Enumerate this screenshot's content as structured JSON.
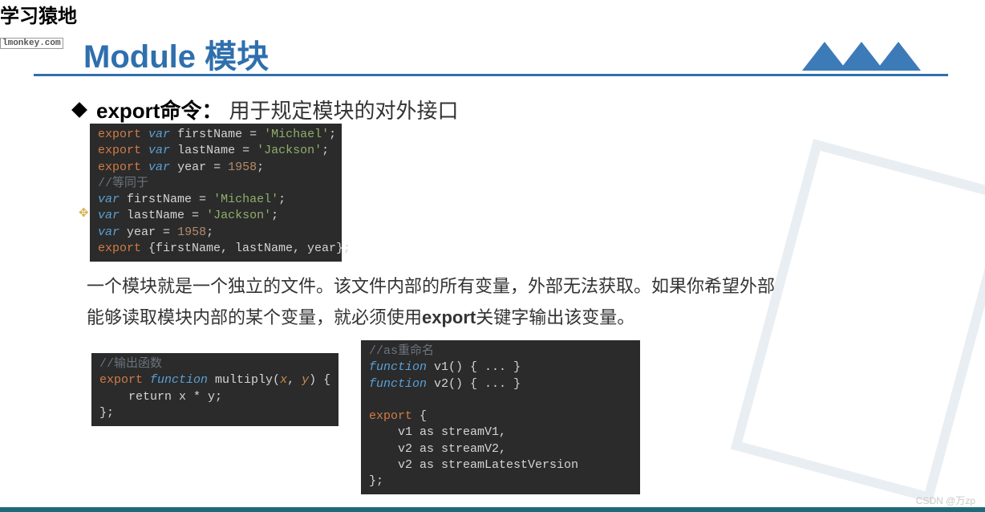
{
  "logo": {
    "main": "学习猿地",
    "sub": "lmonkey.com"
  },
  "slide": {
    "title": "Module 模块"
  },
  "bullet": {
    "strong": "export命令：",
    "rest": "用于规定模块的对外接口"
  },
  "code1": {
    "l1_kw": "export",
    "l1_var": "var",
    "l1_name": "firstName",
    "l1_eq": " = ",
    "l1_val": "'Michael'",
    "l1_end": ";",
    "l2_kw": "export",
    "l2_var": "var",
    "l2_name": "lastName",
    "l2_eq": " = ",
    "l2_val": "'Jackson'",
    "l2_end": ";",
    "l3_kw": "export",
    "l3_var": "var",
    "l3_name": "year",
    "l3_eq": " = ",
    "l3_val": "1958",
    "l3_end": ";",
    "l4_cmt": "//等同于",
    "l5_var": "var",
    "l5_name": "firstName",
    "l5_eq": " = ",
    "l5_val": "'Michael'",
    "l5_end": ";",
    "l6_var": "var",
    "l6_name": "lastName",
    "l6_eq": " = ",
    "l6_val": "'Jackson'",
    "l6_end": ";",
    "l7_var": "var",
    "l7_name": "year",
    "l7_eq": " = ",
    "l7_val": "1958",
    "l7_end": ";",
    "l8_kw": "export",
    "l8_rest": " {firstName, lastName, year};"
  },
  "paragraph": {
    "p1": "一个模块就是一个独立的文件。该文件内部的所有变量，外部无法获取。如果你希望外部",
    "p2a": "能够读取模块内部的某个变量，就必须使用",
    "p2b": "export",
    "p2c": "关键字输出该变量。"
  },
  "code2": {
    "l1_cmt": "//输出函数",
    "l2_kw": "export",
    "l2_func": "function",
    "l2_name": " multiply(",
    "l2_px": "x",
    "l2_c": ", ",
    "l2_py": "y",
    "l2_close": ") {",
    "l3": "    return x * y;",
    "l4": "};"
  },
  "code3": {
    "l1_cmt": "//as重命名",
    "l2_func": "function",
    "l2_rest": " v1() { ... }",
    "l3_func": "function",
    "l3_rest": " v2() { ... }",
    "blank": "",
    "l5_kw": "export",
    "l5_rest": " {",
    "l6": "    v1 as streamV1,",
    "l7": "    v2 as streamV2,",
    "l8": "    v2 as streamLatestVersion",
    "l9": "};"
  },
  "watermark": "CSDN @万zp"
}
